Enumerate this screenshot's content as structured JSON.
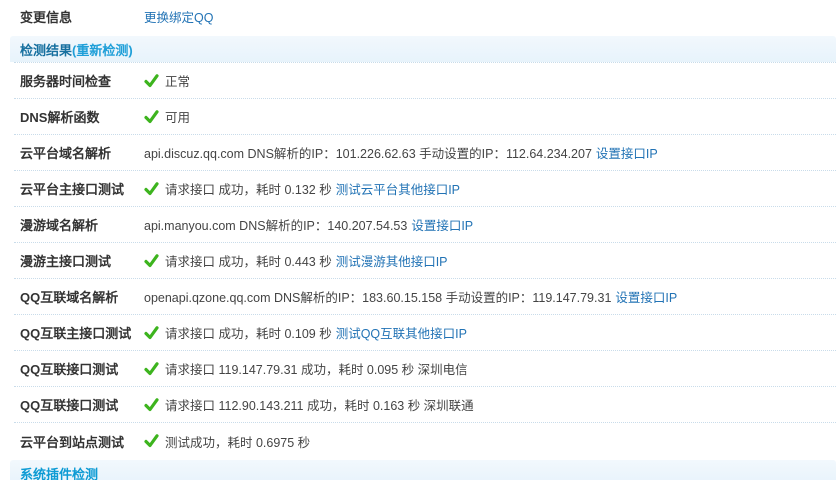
{
  "change_info": {
    "label": "变更信息",
    "link_label": "更换绑定QQ"
  },
  "results_header": {
    "title": "检测结果",
    "refresh_link": "(重新检测)"
  },
  "rows": [
    {
      "label": "服务器时间检查",
      "ok": true,
      "segments": [
        {
          "type": "text",
          "text": "正常"
        }
      ]
    },
    {
      "label": "DNS解析函数",
      "ok": true,
      "segments": [
        {
          "type": "text",
          "text": "可用"
        }
      ]
    },
    {
      "label": "云平台域名解析",
      "ok": false,
      "segments": [
        {
          "type": "text",
          "text": "api.discuz.qq.com DNS解析的IP：101.226.62.63 手动设置的IP：112.64.234.207"
        },
        {
          "type": "link",
          "text": "设置接口IP"
        }
      ]
    },
    {
      "label": "云平台主接口测试",
      "ok": true,
      "segments": [
        {
          "type": "text",
          "text": "请求接口 成功，耗时 0.132 秒"
        },
        {
          "type": "link",
          "text": "测试云平台其他接口IP"
        }
      ]
    },
    {
      "label": "漫游域名解析",
      "ok": false,
      "segments": [
        {
          "type": "text",
          "text": "api.manyou.com DNS解析的IP：140.207.54.53"
        },
        {
          "type": "link",
          "text": "设置接口IP"
        }
      ]
    },
    {
      "label": "漫游主接口测试",
      "ok": true,
      "segments": [
        {
          "type": "text",
          "text": "请求接口 成功，耗时 0.443 秒"
        },
        {
          "type": "link",
          "text": "测试漫游其他接口IP"
        }
      ]
    },
    {
      "label": "QQ互联域名解析",
      "ok": false,
      "segments": [
        {
          "type": "text",
          "text": "openapi.qzone.qq.com DNS解析的IP：183.60.15.158 手动设置的IP：119.147.79.31"
        },
        {
          "type": "link",
          "text": "设置接口IP"
        }
      ]
    },
    {
      "label": "QQ互联主接口测试",
      "ok": true,
      "segments": [
        {
          "type": "text",
          "text": "请求接口 成功，耗时 0.109 秒"
        },
        {
          "type": "link",
          "text": "测试QQ互联其他接口IP"
        }
      ]
    },
    {
      "label": "QQ互联接口测试",
      "ok": true,
      "segments": [
        {
          "type": "text",
          "text": "请求接口 119.147.79.31 成功，耗时 0.095 秒 深圳电信"
        }
      ]
    },
    {
      "label": "QQ互联接口测试",
      "ok": true,
      "segments": [
        {
          "type": "text",
          "text": "请求接口 112.90.143.211 成功，耗时 0.163 秒 深圳联通"
        }
      ]
    },
    {
      "label": "云平台到站点测试",
      "ok": true,
      "segments": [
        {
          "type": "text",
          "text": "测试成功，耗时 0.6975 秒"
        }
      ]
    }
  ],
  "plugins_header": {
    "title": "系统插件检测"
  },
  "colors": {
    "link": "#2273b5",
    "header_title": "#17709f",
    "header_refresh": "#1f9fd8",
    "bottom_header_title": "#0d9bd4",
    "check_green": "#3db41e",
    "dotted_border": "#c9dcea",
    "band_background": "#ecf5fb",
    "label_text": "#333333",
    "value_text": "#444444"
  }
}
